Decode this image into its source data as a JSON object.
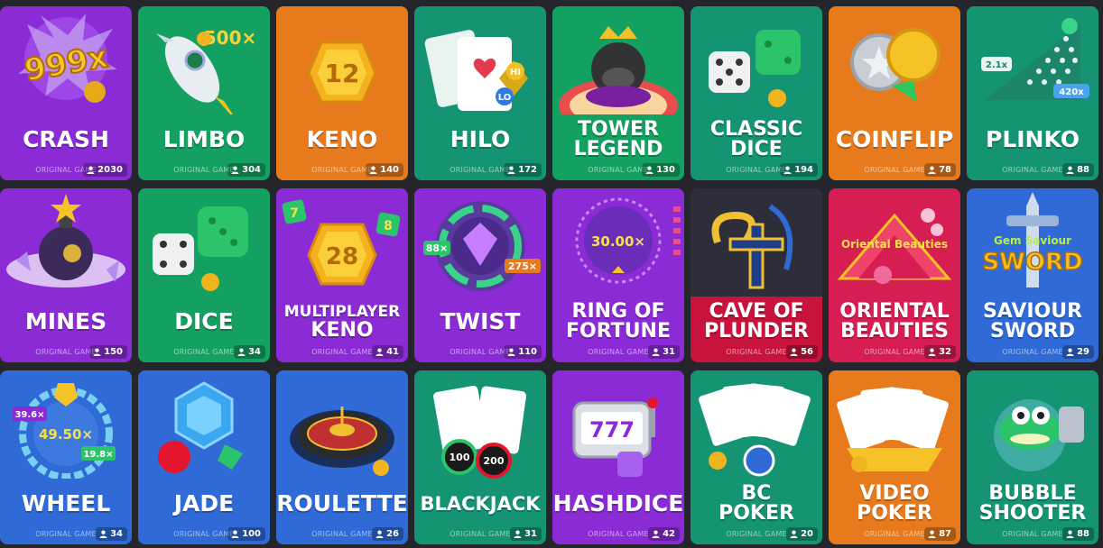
{
  "subtitle": "ORIGINAL GAME",
  "games": [
    {
      "name": "crash",
      "title": [
        "CRASH"
      ],
      "players": "2030",
      "bg": "#8b2bd6"
    },
    {
      "name": "limbo",
      "title": [
        "LIMBO"
      ],
      "players": "304",
      "bg": "#14a060"
    },
    {
      "name": "keno",
      "title": [
        "KENO"
      ],
      "players": "140",
      "bg": "#e67a1c"
    },
    {
      "name": "hilo",
      "title": [
        "HILO"
      ],
      "players": "172",
      "bg": "#149472"
    },
    {
      "name": "tower-legend",
      "title": [
        "TOWER",
        "LEGEND"
      ],
      "players": "130",
      "bg": "#14a060"
    },
    {
      "name": "classic-dice",
      "title": [
        "CLASSIC",
        "DICE"
      ],
      "players": "194",
      "bg": "#149472"
    },
    {
      "name": "coinflip",
      "title": [
        "COINFLIP"
      ],
      "players": "78",
      "bg": "#e67a1c"
    },
    {
      "name": "plinko",
      "title": [
        "PLINKO"
      ],
      "players": "88",
      "bg": "#149472"
    },
    {
      "name": "mines",
      "title": [
        "MINES"
      ],
      "players": "150",
      "bg": "#8b2bd6"
    },
    {
      "name": "dice",
      "title": [
        "DICE"
      ],
      "players": "34",
      "bg": "#14a060"
    },
    {
      "name": "multiplayer-keno",
      "title": [
        "MULTIPLAYER",
        "KENO"
      ],
      "players": "41",
      "bg": "#8b2bd6"
    },
    {
      "name": "twist",
      "title": [
        "TWIST"
      ],
      "players": "110",
      "bg": "#8b2bd6"
    },
    {
      "name": "ring-of-fortune",
      "title": [
        "RING OF",
        "FORTUNE"
      ],
      "players": "31",
      "bg": "#8b2bd6"
    },
    {
      "name": "cave-of-plunder",
      "title": [
        "CAVE OF",
        "PLUNDER"
      ],
      "players": "56",
      "bg": "#c8143c"
    },
    {
      "name": "oriental-beauties",
      "title": [
        "ORIENTAL",
        "BEAUTIES"
      ],
      "players": "32",
      "bg": "#d61e52"
    },
    {
      "name": "saviour-sword",
      "title": [
        "SAVIOUR",
        "SWORD"
      ],
      "players": "29",
      "bg": "#2f6ad6"
    },
    {
      "name": "wheel",
      "title": [
        "WHEEL"
      ],
      "players": "34",
      "bg": "#2f6ad6"
    },
    {
      "name": "jade",
      "title": [
        "JADE"
      ],
      "players": "100",
      "bg": "#2f6ad6"
    },
    {
      "name": "roulette",
      "title": [
        "ROULETTE"
      ],
      "players": "26",
      "bg": "#2f6ad6"
    },
    {
      "name": "blackjack",
      "title": [
        "BLACKJACK"
      ],
      "players": "31",
      "bg": "#149472"
    },
    {
      "name": "hashdice",
      "title": [
        "HASHDICE"
      ],
      "players": "42",
      "bg": "#8b2bd6"
    },
    {
      "name": "bc-poker",
      "title": [
        "BC",
        "POKER"
      ],
      "players": "20",
      "bg": "#149472"
    },
    {
      "name": "video-poker",
      "title": [
        "VIDEO",
        "POKER"
      ],
      "players": "87",
      "bg": "#e67a1c"
    },
    {
      "name": "bubble-shooter",
      "title": [
        "BUBBLE",
        "SHOOTER"
      ],
      "players": "88",
      "bg": "#149472"
    }
  ],
  "art_labels": {
    "crash": "999x",
    "limbo": "500×",
    "keno": "12",
    "hilo_hi": "HI",
    "hilo_lo": "LO",
    "plinko_left": "2.1x",
    "plinko_right": "420x",
    "mkeno_center": "28",
    "mkeno_left": "7",
    "mkeno_right": "8",
    "twist_left": "88×",
    "twist_right": "275×",
    "ring": "30.00×",
    "oriental": "Oriental Beauties",
    "sword_top": "Gem Saviour",
    "sword_main": "SWORD",
    "wheel_center": "49.50×",
    "wheel_left": "39.6×",
    "wheel_right": "19.8×",
    "chip1": "100",
    "chip2": "200",
    "slots": "777"
  }
}
